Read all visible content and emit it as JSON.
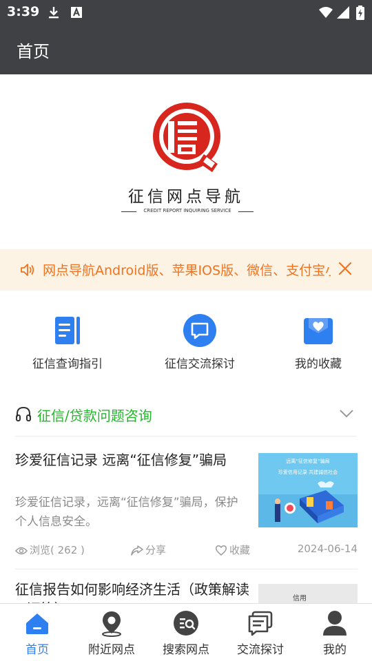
{
  "status_bar": {
    "time": "3:39"
  },
  "app_bar": {
    "title": "首页"
  },
  "logo": {
    "name": "征信网点导航",
    "subtitle": "CREDIT REPORT INQUIRING SERVICE"
  },
  "notice": {
    "text": "网点导航Android版、苹果IOS版、微信、支付宝小程序全面上线"
  },
  "quick_menu": [
    {
      "label": "征信查询指引",
      "icon": "document-icon",
      "color": "#2e7ff0"
    },
    {
      "label": "征信交流探讨",
      "icon": "chat-bubble-icon",
      "color": "#2e7ff0"
    },
    {
      "label": "我的收藏",
      "icon": "favorite-box-icon",
      "color": "#2e7ff0"
    }
  ],
  "section": {
    "title": "征信/贷款问题咨询",
    "accent_color": "#21b82a"
  },
  "articles": [
    {
      "title": "珍爱征信记录 远离“征信修复”骗局",
      "description": "珍爱征信记录，远离“征信修复”骗局，保护个人信息安全。",
      "views_label": "浏览",
      "views": "( 262 )",
      "share_label": "分享",
      "favorite_label": "收藏",
      "date": "2024-06-14",
      "thumb_line1": "远离“征信修复”骗局",
      "thumb_line2": "珍爱信用记录 共建诚信社会"
    },
    {
      "title": "征信报告如何影响经济生活（政策解读+证策）",
      "description": "",
      "thumb_text": "信用"
    }
  ],
  "bottom_nav": [
    {
      "label": "首页",
      "icon": "home-icon",
      "active": true
    },
    {
      "label": "附近网点",
      "icon": "location-pin-icon",
      "active": false
    },
    {
      "label": "搜索网点",
      "icon": "search-icon",
      "active": false
    },
    {
      "label": "交流探讨",
      "icon": "chat-icon",
      "active": false
    },
    {
      "label": "我的",
      "icon": "user-icon",
      "active": false
    }
  ],
  "colors": {
    "primary": "#2e7ff0",
    "notice_text": "#f0731f",
    "logo_red": "#d7261e",
    "appbar": "#3f4144"
  }
}
